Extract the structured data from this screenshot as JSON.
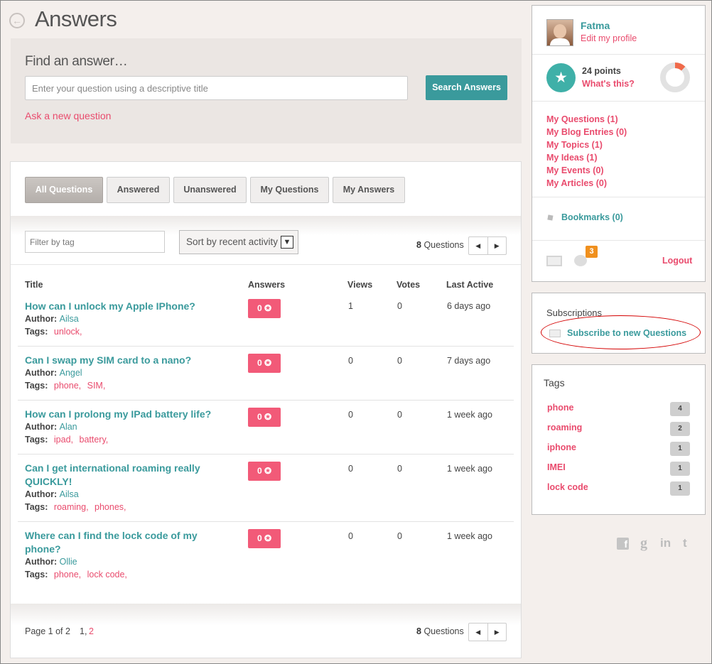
{
  "page": {
    "title": "Answers"
  },
  "find": {
    "heading": "Find an answer…",
    "placeholder": "Enter your question using a descriptive title",
    "search_button": "Search Answers",
    "ask_link": "Ask a new question"
  },
  "tabs": [
    "All Questions",
    "Answered",
    "Unanswered",
    "My Questions",
    "My Answers"
  ],
  "filters": {
    "tag_placeholder": "Filter by tag",
    "sort_value": "Sort by recent activity",
    "count": "8",
    "count_label": "Questions"
  },
  "table": {
    "headers": {
      "title": "Title",
      "answers": "Answers",
      "views": "Views",
      "votes": "Votes",
      "last_active": "Last Active"
    },
    "author_label": "Author:",
    "tags_label": "Tags:",
    "rows": [
      {
        "title": "How can I unlock my Apple IPhone?",
        "author": "Ailsa",
        "tags": [
          "unlock,"
        ],
        "answers": "0",
        "views": "1",
        "votes": "0",
        "last_active": "6 days ago"
      },
      {
        "title": "Can I swap my SIM card to a nano?",
        "author": "Angel",
        "tags": [
          "phone,",
          "SIM,"
        ],
        "answers": "0",
        "views": "0",
        "votes": "0",
        "last_active": "7 days ago"
      },
      {
        "title": "How can I prolong my IPad battery life?",
        "author": "Alan",
        "tags": [
          "ipad,",
          "battery,"
        ],
        "answers": "0",
        "views": "0",
        "votes": "0",
        "last_active": "1 week ago"
      },
      {
        "title": "Can I get international roaming really QUICKLY!",
        "author": "Ailsa",
        "tags": [
          "roaming,",
          "phones,"
        ],
        "answers": "0",
        "views": "0",
        "votes": "0",
        "last_active": "1 week ago"
      },
      {
        "title": "Where can I find the lock code of my phone?",
        "author": "Ollie",
        "tags": [
          "phone,",
          "lock code,"
        ],
        "answers": "0",
        "views": "0",
        "votes": "0",
        "last_active": "1 week ago"
      }
    ]
  },
  "footer": {
    "page_text": "Page 1 of 2",
    "page1": "1,",
    "page2": "2"
  },
  "profile": {
    "name": "Fatma",
    "edit_link": "Edit my profile",
    "points_value": "24",
    "points_label": "points",
    "whats_this": "What's this?",
    "points_progress": 0.12,
    "links": [
      "My Questions (1)",
      "My Blog Entries (0)",
      "My Topics (1)",
      "My Ideas (1)",
      "My Events (0)",
      "My Articles (0)"
    ],
    "bookmarks": "Bookmarks (0)",
    "notification_count": "3",
    "logout": "Logout"
  },
  "subscriptions": {
    "heading": "Subscriptions",
    "link": "Subscribe to new Questions"
  },
  "tags": {
    "heading": "Tags",
    "items": [
      {
        "name": "phone",
        "count": "4"
      },
      {
        "name": "roaming",
        "count": "2"
      },
      {
        "name": "iphone",
        "count": "1"
      },
      {
        "name": "IMEI",
        "count": "1"
      },
      {
        "name": "lock code",
        "count": "1"
      }
    ]
  },
  "social": {
    "facebook": "f",
    "google": "g",
    "linkedin": "in",
    "twitter": "t"
  },
  "colors": {
    "teal": "#3a9a9c",
    "pink": "#e94b6d",
    "badge": "#f25a78",
    "annotation": "#d40000"
  }
}
